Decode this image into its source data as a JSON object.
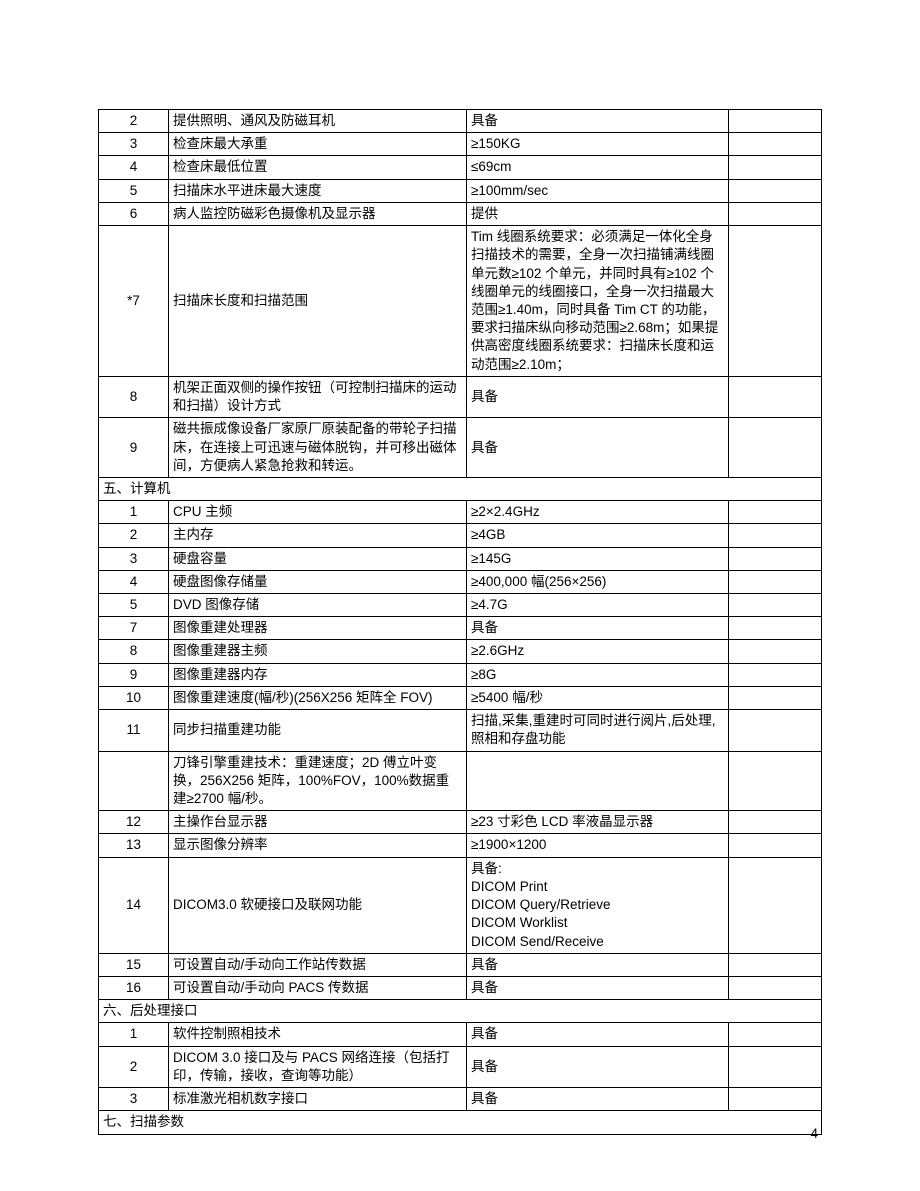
{
  "page_number": "4",
  "rows": [
    {
      "type": "row",
      "idx": "2",
      "desc": "提供照明、通风及防磁耳机",
      "val": "具备",
      "note": ""
    },
    {
      "type": "row",
      "idx": "3",
      "desc": "检查床最大承重",
      "val": "≥150KG",
      "note": ""
    },
    {
      "type": "row",
      "idx": "4",
      "desc": "检查床最低位置",
      "val": "≤69cm",
      "note": ""
    },
    {
      "type": "row",
      "idx": "5",
      "desc": "扫描床水平进床最大速度",
      "val": "≥100mm/sec",
      "note": ""
    },
    {
      "type": "row",
      "idx": "6",
      "desc": "病人监控防磁彩色摄像机及显示器",
      "val": "提供",
      "note": ""
    },
    {
      "type": "row",
      "idx": "*7",
      "desc": "扫描床长度和扫描范围",
      "val": "Tim 线圈系统要求：必须满足一体化全身扫描技术的需要，全身一次扫描铺满线圈单元数≥102 个单元，并同时具有≥102 个线圈单元的线圈接口，全身一次扫描最大范围≥1.40m，同时具备 Tim CT 的功能，要求扫描床纵向移动范围≥2.68m；如果提供高密度线圈系统要求：扫描床长度和运动范围≥2.10m；",
      "note": ""
    },
    {
      "type": "row",
      "idx": "8",
      "desc": "机架正面双侧的操作按钮（可控制扫描床的运动和扫描）设计方式",
      "val": "具备",
      "note": ""
    },
    {
      "type": "row",
      "idx": "9",
      "desc": "磁共振成像设备厂家原厂原装配备的带轮子扫描床，在连接上可迅速与磁体脱钩，并可移出磁体间，方便病人紧急抢救和转运。",
      "val": "具备",
      "note": ""
    },
    {
      "type": "section",
      "title": "五、计算机"
    },
    {
      "type": "row",
      "idx": "1",
      "desc": "CPU 主频",
      "val": "≥2×2.4GHz",
      "note": ""
    },
    {
      "type": "row",
      "idx": "2",
      "desc": "主内存",
      "val": "≥4GB",
      "note": ""
    },
    {
      "type": "row",
      "idx": "3",
      "desc": "硬盘容量",
      "val": "≥145G",
      "note": ""
    },
    {
      "type": "row",
      "idx": "4",
      "desc": "硬盘图像存储量",
      "val": "≥400,000 幅(256×256)",
      "note": ""
    },
    {
      "type": "row",
      "idx": "5",
      "desc": "DVD 图像存储",
      "val": "≥4.7G",
      "note": ""
    },
    {
      "type": "row",
      "idx": "7",
      "desc": "图像重建处理器",
      "val": "具备",
      "note": ""
    },
    {
      "type": "row",
      "idx": "8",
      "desc": "图像重建器主频",
      "val": "≥2.6GHz",
      "note": ""
    },
    {
      "type": "row",
      "idx": "9",
      "desc": "图像重建器内存",
      "val": "≥8G",
      "note": ""
    },
    {
      "type": "row",
      "idx": "10",
      "desc": "图像重建速度(幅/秒)(256X256 矩阵全 FOV)",
      "val": "≥5400 幅/秒",
      "note": ""
    },
    {
      "type": "row",
      "idx": "11",
      "desc": "同步扫描重建功能",
      "val": "扫描,采集,重建时可同时进行阅片,后处理,照相和存盘功能",
      "note": ""
    },
    {
      "type": "row",
      "idx": "",
      "desc": "刀锋引擎重建技术：重建速度；2D 傅立叶变换，256X256 矩阵，100%FOV，100%数据重建≥2700 幅/秒。",
      "val": "",
      "note": ""
    },
    {
      "type": "row",
      "idx": "12",
      "desc": "主操作台显示器",
      "val": "≥23 寸彩色 LCD 率液晶显示器",
      "note": ""
    },
    {
      "type": "row",
      "idx": "13",
      "desc": "显示图像分辨率",
      "val": "≥1900×1200",
      "note": ""
    },
    {
      "type": "row",
      "idx": "14",
      "desc": "DICOM3.0 软硬接口及联网功能",
      "val": "具备:\nDICOM Print\nDICOM Query/Retrieve\nDICOM Worklist\nDICOM Send/Receive",
      "note": ""
    },
    {
      "type": "row",
      "idx": "15",
      "desc": "可设置自动/手动向工作站传数据",
      "val": "具备",
      "note": ""
    },
    {
      "type": "row",
      "idx": "16",
      "desc": "可设置自动/手动向 PACS 传数据",
      "val": "具备",
      "note": ""
    },
    {
      "type": "section",
      "title": "六、后处理接口"
    },
    {
      "type": "row",
      "idx": "1",
      "desc": "软件控制照相技术",
      "val": "具备",
      "note": ""
    },
    {
      "type": "row",
      "idx": "2",
      "desc": "DICOM 3.0 接口及与 PACS 网络连接（包括打印，传输，接收，查询等功能）",
      "val": "具备",
      "note": ""
    },
    {
      "type": "row",
      "idx": "3",
      "desc": "标准激光相机数字接口",
      "val": "具备",
      "note": ""
    },
    {
      "type": "section",
      "title": "七、扫描参数"
    }
  ]
}
